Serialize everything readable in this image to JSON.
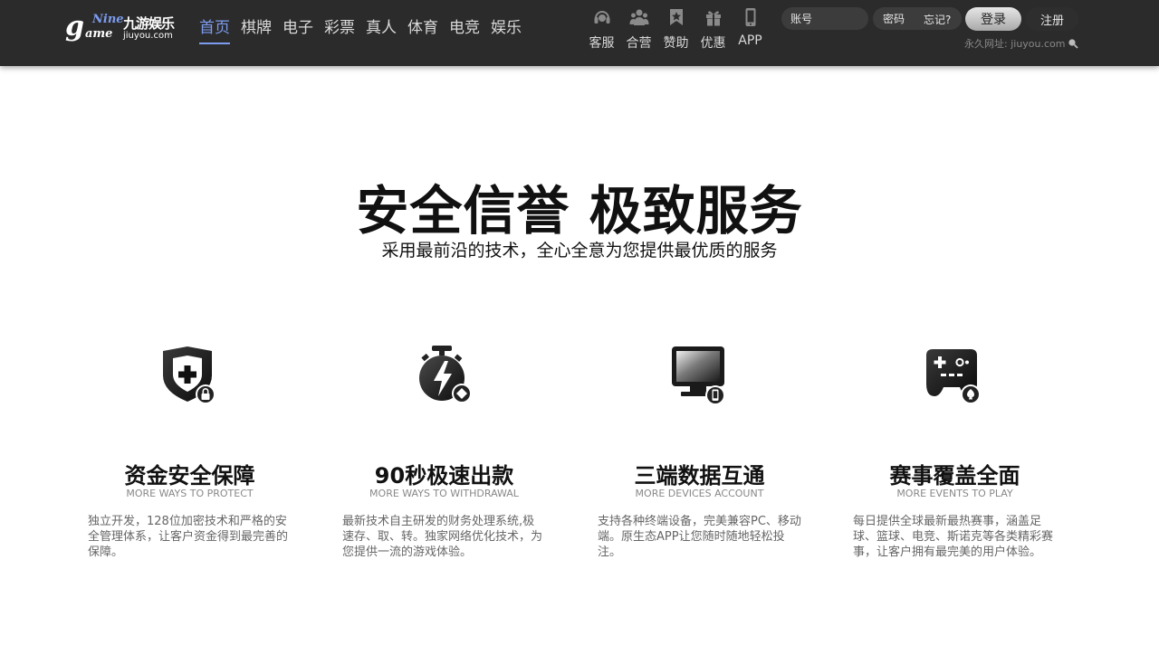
{
  "brand": {
    "logo_g": "g",
    "logo_nine": "Nine",
    "logo_ame": "ame",
    "logo_cn": "九游娱乐",
    "logo_domain": "jiuyou.com"
  },
  "nav": {
    "items": [
      {
        "label": "首页",
        "active": true
      },
      {
        "label": "棋牌"
      },
      {
        "label": "电子"
      },
      {
        "label": "彩票"
      },
      {
        "label": "真人"
      },
      {
        "label": "体育"
      },
      {
        "label": "电竞"
      },
      {
        "label": "娱乐"
      }
    ]
  },
  "quick_links": [
    {
      "label": "客服",
      "icon": "headset-icon"
    },
    {
      "label": "合营",
      "icon": "partners-icon"
    },
    {
      "label": "赞助",
      "icon": "sponsor-badge-icon"
    },
    {
      "label": "优惠",
      "icon": "gift-icon"
    },
    {
      "label": "APP",
      "icon": "phone-icon"
    }
  ],
  "login": {
    "account_placeholder": "账号",
    "password_placeholder": "密码",
    "forgot_label": "忘记?",
    "login_label": "登录",
    "register_label": "注册",
    "permanent_url": "永久网址: jiuyou.com"
  },
  "hero": {
    "title": "安全信誉 极致服务",
    "subtitle": "采用最前沿的技术，全心全意为您提供最优质的服务"
  },
  "features": [
    {
      "icon": "shield-lock-icon",
      "title": "资金安全保障",
      "subtitle": "MORE WAYS TO PROTECT",
      "description": "独立开发，128位加密技术和严格的安全管理体系，让客户资金得到最完善的保障。"
    },
    {
      "icon": "stopwatch-icon",
      "title": "90秒极速出款",
      "subtitle": "MORE WAYS TO WITHDRAWAL",
      "description": "最新技术自主研发的财务处理系统,极速存、取、转。独家网络优化技术，为您提供一流的游戏体验。"
    },
    {
      "icon": "monitor-devices-icon",
      "title": "三端数据互通",
      "subtitle": "MORE DEVICES ACCOUNT",
      "description": "支持各种终端设备，完美兼容PC、移动端。原生态APP让您随时随地轻松投注。"
    },
    {
      "icon": "gamepad-icon",
      "title": "赛事覆盖全面",
      "subtitle": "MORE EVENTS TO PLAY",
      "description": "每日提供全球最新最热赛事，涵盖足球、篮球、电竞、斯诺克等各类精彩赛事，让客户拥有最完美的用户体验。"
    }
  ],
  "colors": {
    "header_bg": "#2b2b2b",
    "accent": "#7d9cf0",
    "nav_text": "#d9d9d9",
    "page_bg": "#ffffff"
  }
}
